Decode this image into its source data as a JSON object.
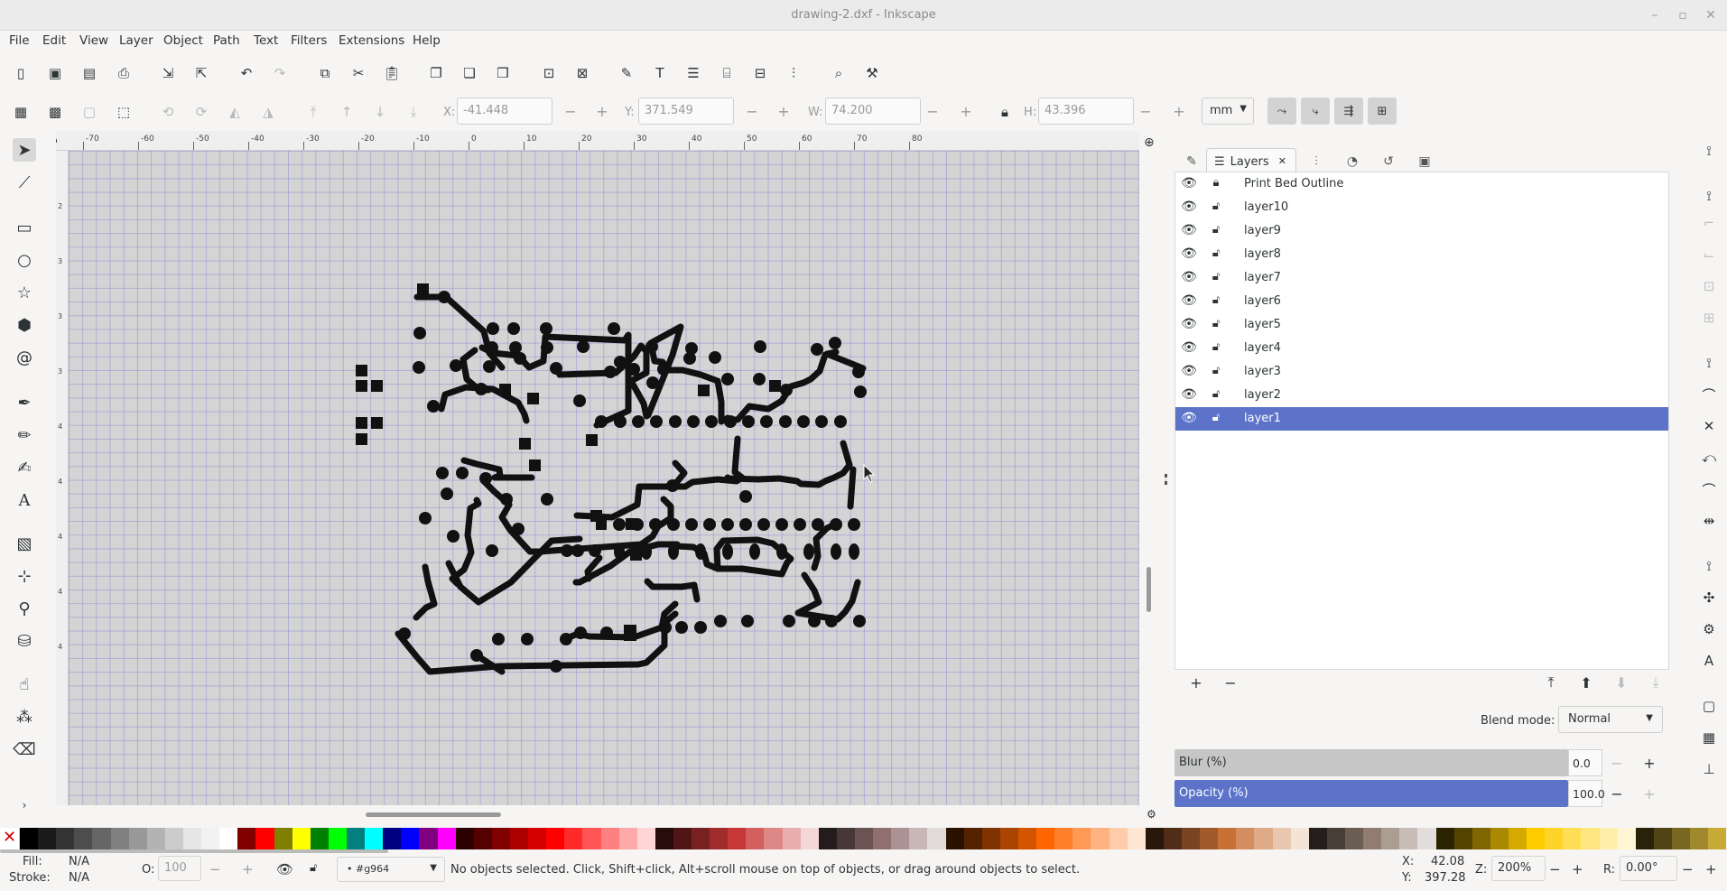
{
  "window": {
    "title": "drawing-2.dxf - Inkscape"
  },
  "menu": [
    "File",
    "Edit",
    "View",
    "Layer",
    "Object",
    "Path",
    "Text",
    "Filters",
    "Extensions",
    "Help"
  ],
  "toolbar": {
    "x_label": "X:",
    "x_value": "-41.448",
    "y_label": "Y:",
    "y_value": "371.549",
    "w_label": "W:",
    "w_value": "74.200",
    "h_label": "H:",
    "h_value": "43.396",
    "unit": "mm",
    "minus": "−",
    "plus": "+"
  },
  "hruler_ticks": [
    "-70",
    "-60",
    "-50",
    "-40",
    "-30",
    "-20",
    "-10",
    "0",
    "10",
    "20",
    "30",
    "40",
    "50",
    "60",
    "70",
    "80"
  ],
  "vruler_ticks": [
    "2",
    "3",
    "3",
    "3",
    "4",
    "4",
    "4",
    "4",
    "4"
  ],
  "dock": {
    "layers_tab_label": "Layers",
    "layers": [
      {
        "name": "Print Bed Outline",
        "visible": true,
        "locked": true,
        "selected": false
      },
      {
        "name": "layer10",
        "visible": true,
        "locked": false,
        "selected": false
      },
      {
        "name": "layer9",
        "visible": true,
        "locked": false,
        "selected": false
      },
      {
        "name": "layer8",
        "visible": true,
        "locked": false,
        "selected": false
      },
      {
        "name": "layer7",
        "visible": true,
        "locked": false,
        "selected": false
      },
      {
        "name": "layer6",
        "visible": true,
        "locked": false,
        "selected": false
      },
      {
        "name": "layer5",
        "visible": true,
        "locked": false,
        "selected": false
      },
      {
        "name": "layer4",
        "visible": true,
        "locked": false,
        "selected": false
      },
      {
        "name": "layer3",
        "visible": true,
        "locked": false,
        "selected": false
      },
      {
        "name": "layer2",
        "visible": true,
        "locked": false,
        "selected": false
      },
      {
        "name": "layer1",
        "visible": true,
        "locked": false,
        "selected": true
      }
    ],
    "blend_label": "Blend mode:",
    "blend_value": "Normal",
    "blur_label": "Blur (%)",
    "blur_value": "0.0",
    "opacity_label": "Opacity (%)",
    "opacity_value": "100.0"
  },
  "status": {
    "fill_label": "Fill:",
    "fill_value": "N/A",
    "stroke_label": "Stroke:",
    "stroke_value": "N/A",
    "o_label": "O:",
    "o_value": "100",
    "layer_value": "• #g964",
    "message": "No objects selected. Click, Shift+click, Alt+scroll mouse on top of objects, or drag around objects to select.",
    "cursor_x_label": "X:",
    "cursor_x": "42.08",
    "cursor_y_label": "Y:",
    "cursor_y": "397.28",
    "zoom_label": "Z:",
    "zoom_value": "200%",
    "rotate_label": "R:",
    "rotate_value": "0.00°"
  },
  "palette": [
    "#000000",
    "#1a1a1a",
    "#333333",
    "#4d4d4d",
    "#666666",
    "#808080",
    "#999999",
    "#b3b3b3",
    "#cccccc",
    "#e6e6e6",
    "#f2f2f2",
    "#ffffff",
    "#800000",
    "#ff0000",
    "#808000",
    "#ffff00",
    "#008000",
    "#00ff00",
    "#008080",
    "#00ffff",
    "#000080",
    "#0000ff",
    "#800080",
    "#ff00ff",
    "#2b0000",
    "#550000",
    "#800000",
    "#aa0000",
    "#d40000",
    "#ff0000",
    "#ff2a2a",
    "#ff5555",
    "#ff8080",
    "#ffaaaa",
    "#ffd5d5",
    "#280b0b",
    "#501616",
    "#782121",
    "#a02c2c",
    "#c83737",
    "#d35f5f",
    "#de8787",
    "#e9afaf",
    "#f4d7d7",
    "#241c1c",
    "#483737",
    "#6c5353",
    "#916f6f",
    "#ac9393",
    "#c8b7b7",
    "#e3dbdb",
    "#2b1100",
    "#552200",
    "#803300",
    "#aa4400",
    "#d45500",
    "#ff6600",
    "#ff7f2a",
    "#ff9955",
    "#ffb380",
    "#ffccaa",
    "#ffe6d5",
    "#28170b",
    "#502d16",
    "#784421",
    "#a05a2c",
    "#c87137",
    "#d38d5f",
    "#deaa87",
    "#e9c6af",
    "#f4e3d7",
    "#241f1c",
    "#483e37",
    "#6c5d53",
    "#917c6f",
    "#ac9d93",
    "#c8beb7",
    "#e3dedb",
    "#2b2200",
    "#554400",
    "#806600",
    "#aa8800",
    "#d4aa00",
    "#ffcc00",
    "#ffd42a",
    "#ffdd55",
    "#ffe680",
    "#ffeeaa",
    "#fff6d5",
    "#28220b",
    "#504416",
    "#786721",
    "#a0892c",
    "#c8ab37"
  ]
}
